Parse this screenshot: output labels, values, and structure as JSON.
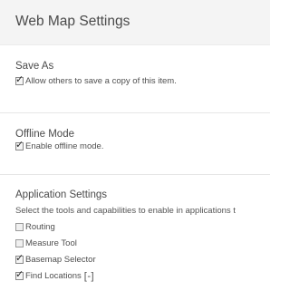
{
  "header": {
    "title": "Web Map Settings"
  },
  "sections": {
    "save_as": {
      "heading": "Save As",
      "options": [
        {
          "label": "Allow others to save a copy of this item.",
          "checked": true
        }
      ]
    },
    "offline_mode": {
      "heading": "Offline Mode",
      "options": [
        {
          "label": "Enable offline mode.",
          "checked": true
        }
      ]
    },
    "application_settings": {
      "heading": "Application Settings",
      "description": "Select the tools and capabilities to enable in applications t",
      "options": [
        {
          "label": "Routing",
          "checked": false
        },
        {
          "label": "Measure Tool",
          "checked": false
        },
        {
          "label": "Basemap Selector",
          "checked": true
        },
        {
          "label": "Find Locations",
          "checked": true
        }
      ],
      "find_locations_toggle": "[-]"
    }
  },
  "icons": {
    "checkmark": "check-icon"
  }
}
